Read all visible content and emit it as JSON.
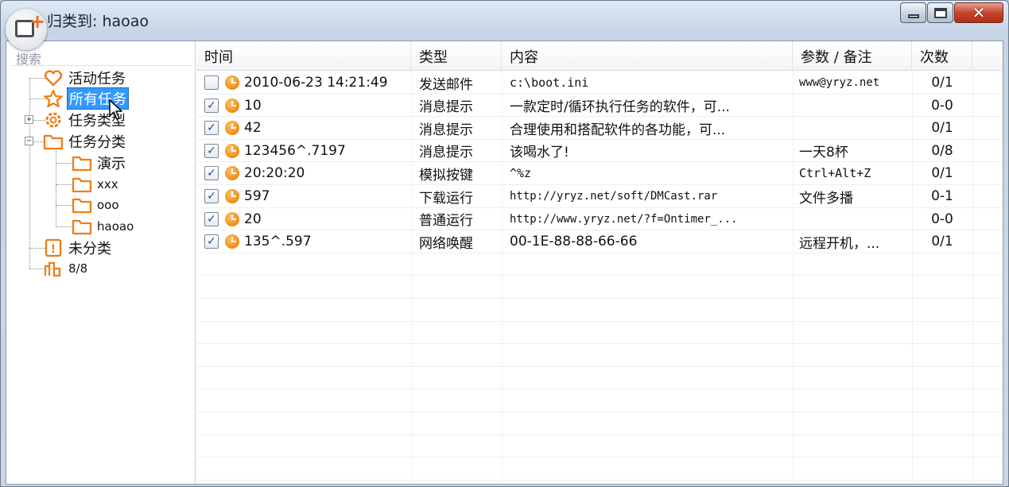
{
  "window": {
    "title": "归类到: haoao",
    "buttons": {
      "minimize": "minimize-icon",
      "maximize": "maximize-icon",
      "close": "close-icon"
    }
  },
  "search": {
    "placeholder": "搜索"
  },
  "tree": {
    "items": [
      {
        "label": "活动任务",
        "icon": "heart-icon"
      },
      {
        "label": "所有任务",
        "icon": "star-icon",
        "selected": true
      },
      {
        "label": "任务类型",
        "icon": "gear-icon"
      },
      {
        "label": "任务分类",
        "icon": "folder-icon"
      },
      {
        "label": "演示",
        "icon": "folder-icon"
      },
      {
        "label": "xxx",
        "icon": "folder-icon"
      },
      {
        "label": "ooo",
        "icon": "folder-icon"
      },
      {
        "label": "haoao",
        "icon": "folder-icon"
      },
      {
        "label": "未分类",
        "icon": "exclamation-icon"
      },
      {
        "label": "8/8",
        "icon": "stats-icon"
      }
    ]
  },
  "table": {
    "columns": [
      "时间",
      "类型",
      "内容",
      "参数 / 备注",
      "次数"
    ],
    "rows": [
      {
        "checked": false,
        "time": "2010-06-23 14:21:49",
        "type": "发送邮件",
        "content": "c:\\boot.ini",
        "param": "www@yryz.net",
        "count": "0/1"
      },
      {
        "checked": true,
        "time": "10",
        "type": "消息提示",
        "content": "一款定时/循环执行任务的软件，可...",
        "param": "",
        "count": "0-0"
      },
      {
        "checked": true,
        "time": "42",
        "type": "消息提示",
        "content": "合理使用和搭配软件的各功能，可...",
        "param": "",
        "count": "0/1"
      },
      {
        "checked": true,
        "time": "123456^.7197",
        "type": "消息提示",
        "content": "该喝水了!",
        "param": "一天8杯",
        "count": "0/8"
      },
      {
        "checked": true,
        "time": "20:20:20",
        "type": "模拟按键",
        "content": "^%z",
        "param": "Ctrl+Alt+Z",
        "count": "0/1"
      },
      {
        "checked": true,
        "time": "597",
        "type": "下载运行",
        "content": "http://yryz.net/soft/DMCast.rar",
        "param": "文件多播",
        "count": "0-1"
      },
      {
        "checked": true,
        "time": "20",
        "type": "普通运行",
        "content": "http://www.yryz.net/?f=Ontimer_...",
        "param": "",
        "count": "0-0"
      },
      {
        "checked": true,
        "time": "135^.597",
        "type": "网络唤醒",
        "content": "00-1E-88-88-66-66",
        "param": "远程开机，...",
        "count": "0/1"
      }
    ]
  }
}
